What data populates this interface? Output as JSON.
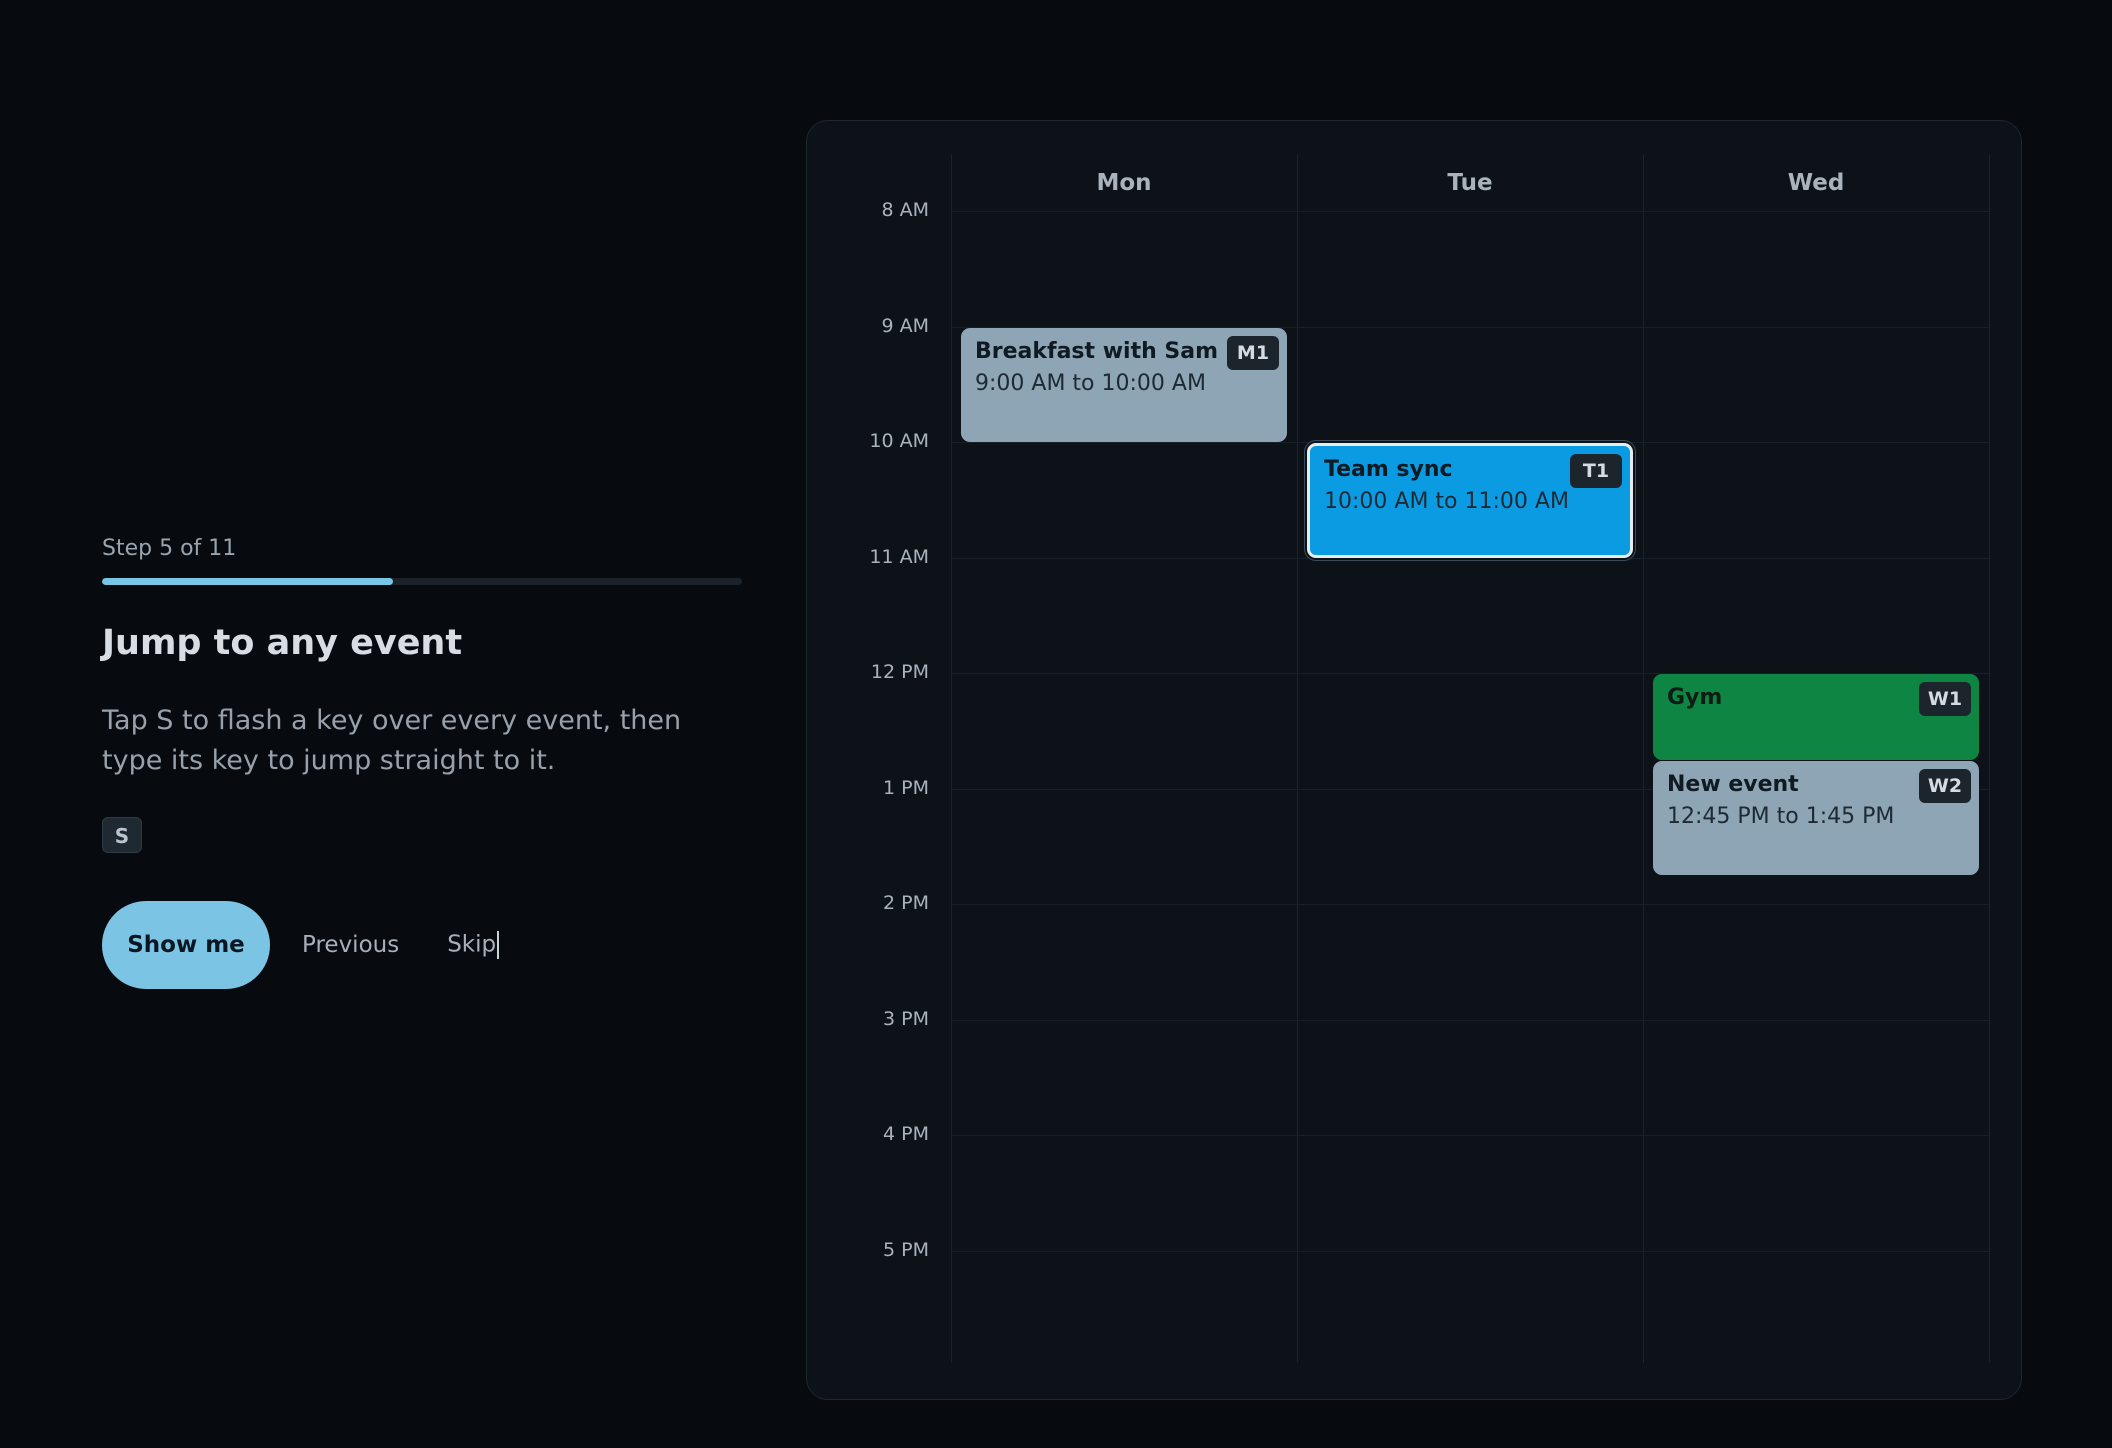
{
  "tour": {
    "step_label": "Step 5 of 11",
    "progress_fraction": 0.4545,
    "title": "Jump to any event",
    "body": "Tap S to flash a key over every event, then type its key to jump straight to it.",
    "key_hint": "S",
    "actions": {
      "primary": "Show me",
      "previous": "Previous",
      "skip": "Skip"
    }
  },
  "calendar": {
    "days": [
      "Mon",
      "Tue",
      "Wed"
    ],
    "hours": [
      "8 AM",
      "9 AM",
      "10 AM",
      "11 AM",
      "12 PM",
      "1 PM",
      "2 PM",
      "3 PM",
      "4 PM",
      "5 PM"
    ],
    "events": [
      {
        "title": "Breakfast with Sam",
        "time": "9:00 AM to 10:00 AM",
        "key": "M1",
        "day": "Mon",
        "color": "#8ea5b6",
        "focused": false
      },
      {
        "title": "Team sync",
        "time": "10:00 AM to 11:00 AM",
        "key": "T1",
        "day": "Tue",
        "color": "#0b9be3",
        "focused": true
      },
      {
        "title": "Gym",
        "time": "",
        "key": "W1",
        "day": "Wed",
        "color": "#0f8543",
        "focused": false
      },
      {
        "title": "New event",
        "time": "12:45 PM to 1:45 PM",
        "key": "W2",
        "day": "Wed",
        "color": "#8ea5b6",
        "focused": false
      }
    ]
  },
  "colors": {
    "background": "#070a0e",
    "accent": "#7cc4e4",
    "event_default": "#8ea5b6",
    "event_focused": "#0b9be3",
    "event_green": "#0f8543"
  }
}
